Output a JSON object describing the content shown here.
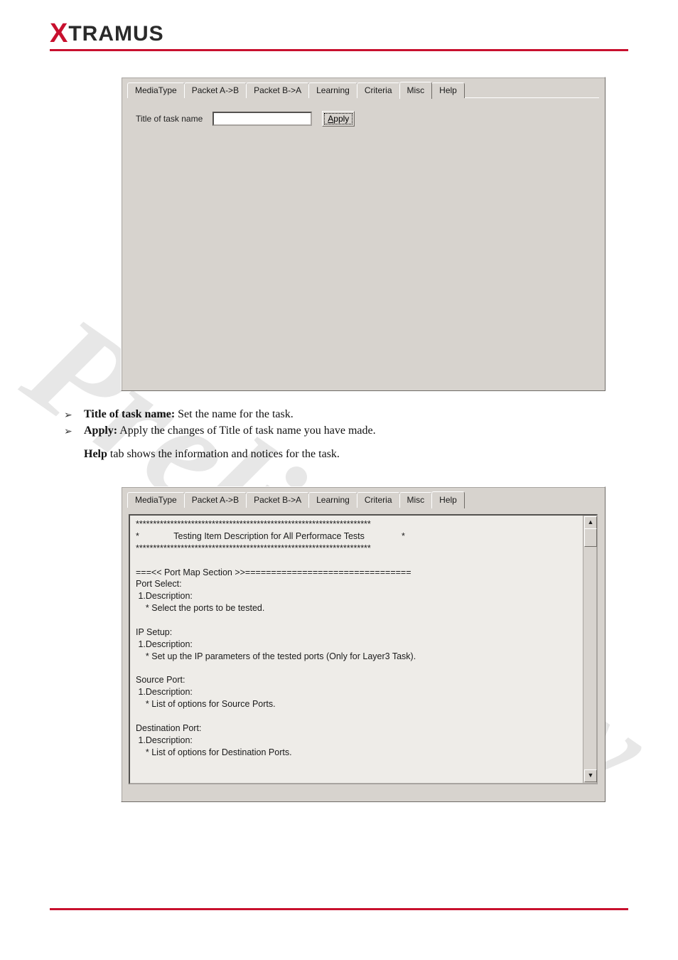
{
  "logo": {
    "x": "X",
    "rest": "TRAMUS"
  },
  "watermark": "Preliminary",
  "tabs": [
    {
      "id": "mediatype",
      "label": "MediaType"
    },
    {
      "id": "packetab",
      "label": "Packet A->B"
    },
    {
      "id": "packetba",
      "label": "Packet B->A"
    },
    {
      "id": "learning",
      "label": "Learning"
    },
    {
      "id": "criteria",
      "label": "Criteria"
    },
    {
      "id": "misc",
      "label": "Misc"
    },
    {
      "id": "help",
      "label": "Help"
    }
  ],
  "panel1": {
    "active_tab_index": 5,
    "title_label": "Title of task name",
    "title_value": "",
    "apply_button": {
      "underline": "A",
      "rest": "pply"
    }
  },
  "bullets": {
    "b1_bold": "Title of task name:",
    "b1_rest": " Set the name for the task.",
    "b2_bold": "Apply:",
    "b2_rest": " Apply the changes of Title of task name you have made.",
    "heading_bold": "Help",
    "heading_rest": " tab shows the information and notices for the task."
  },
  "panel2": {
    "active_tab_index": 6,
    "help_text": "********************************************************************\n*              Testing Item Description for All Performace Tests               *\n********************************************************************\n\n===<< Port Map Section >>================================\nPort Select:\n 1.Description:\n    * Select the ports to be tested.\n\nIP Setup:\n 1.Description:\n    * Set up the IP parameters of the tested ports (Only for Layer3 Task).\n\nSource Port:\n 1.Description:\n    * List of options for Source Ports.\n\nDestination Port:\n 1.Description:\n    * List of options for Destination Ports."
  },
  "scroll": {
    "up": "▲",
    "down": "▼"
  }
}
